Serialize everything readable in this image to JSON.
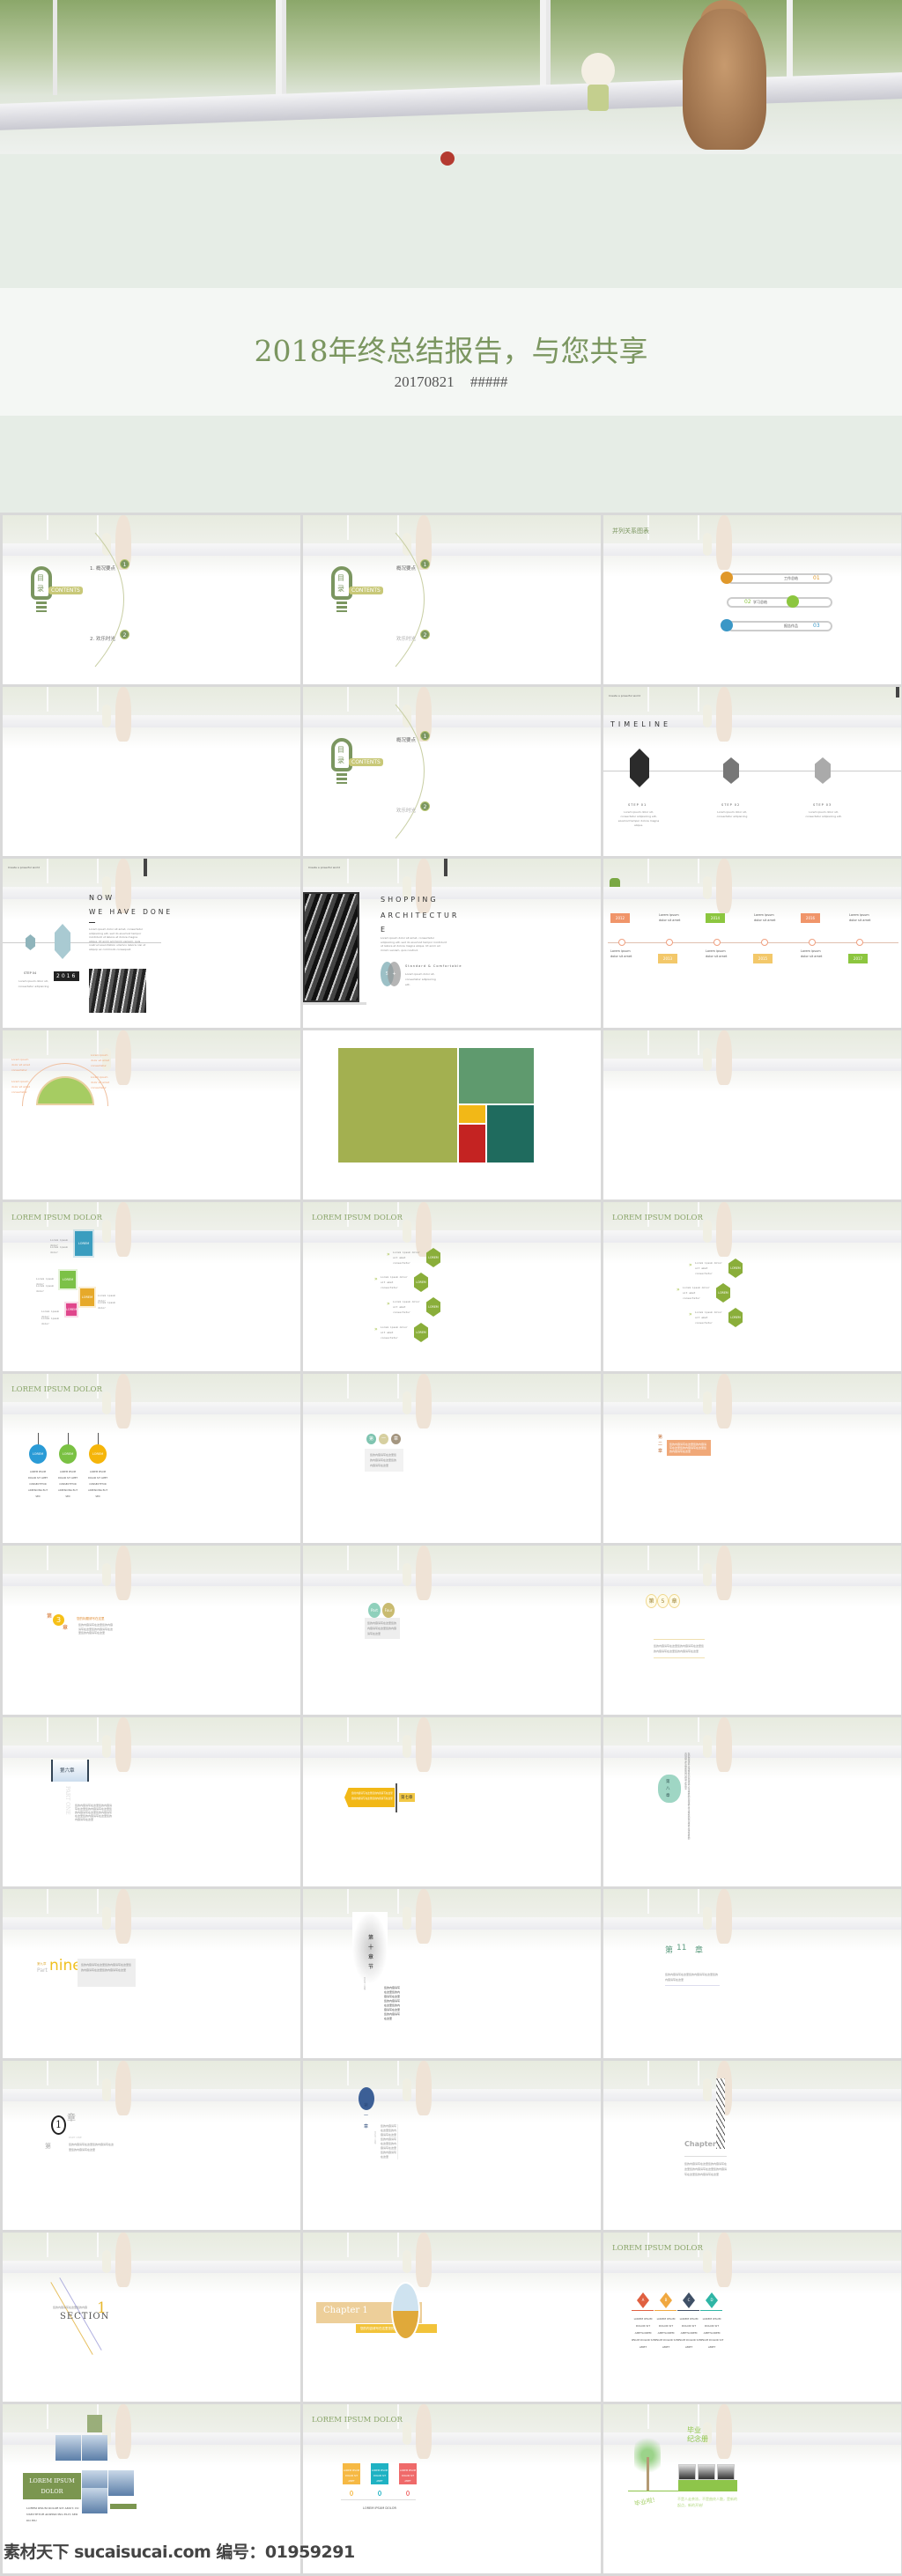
{
  "cover": {
    "title": "2018年终总结报告，与您共享",
    "date": "20170821",
    "author": "#####"
  },
  "colors": {
    "green": "#7b9660",
    "olive": "#8aa04a",
    "orange": "#f0956a",
    "yellow": "#f3c03a",
    "teal": "#3fb4c0",
    "lime": "#8cc63f"
  },
  "slides": [
    {
      "type": "contents",
      "bulb": [
        "目",
        "录"
      ],
      "label": "CONTENTS",
      "nums": [
        "1",
        "2"
      ],
      "items": [
        "1. 概况要点",
        "2. 欢乐时光"
      ]
    },
    {
      "type": "contents",
      "bulb": [
        "目",
        "录"
      ],
      "label": "CONTENTS",
      "nums": [
        "1",
        "2"
      ],
      "items": [
        "概况要点",
        "欢乐时光"
      ]
    },
    {
      "type": "parallel",
      "title": "并列关系图表",
      "items": [
        {
          "label": "工作总结",
          "num": "01"
        },
        {
          "label": "学习总结",
          "num": "02"
        },
        {
          "label": "报告作品",
          "num": "03"
        }
      ]
    },
    {
      "type": "blank"
    },
    {
      "type": "contents",
      "bulb": [
        "目",
        "录"
      ],
      "label": "CONTENTS",
      "nums": [
        "1",
        "2"
      ],
      "items": [
        "概况要点",
        "欢乐时光"
      ]
    },
    {
      "type": "timeline",
      "tag": "Create a powerful world",
      "title": "TIMELINE",
      "steps": [
        {
          "label": "STEP 01",
          "text": "Lorem ipsum dolor sit, consectetur adipisicing elit, eiusmod tempor dolore magna aliqua."
        },
        {
          "label": "STEP 02",
          "text": "Lorem ipsum dolor sit, consectetur adipisicing"
        },
        {
          "label": "STEP 03",
          "text": "Lorem ipsum dolor sit, consectetur adipisicing elit."
        }
      ]
    },
    {
      "type": "nowdone",
      "tag": "Create a powerful world",
      "title1": "NOW",
      "title2": "WE HAVE DONE",
      "step": "STEP 04",
      "steptext": "Lorem ipsum dolor sit, consectetur adipisicing",
      "year": "2016",
      "body": "Lorem ipsum dolor sit amet, consectetur adipisicing elit, sed do eiusmod tempor incididunt ut labore et dolore magna aliqua. Ut enim ad minim veniam, quis nostrud exercitation ullamco laboris nisi ut aliquip ex commodo consequat."
    },
    {
      "type": "shopping",
      "tag": "Create a powerful world",
      "title1": "SHOPPING",
      "title2": "ARCHITECTUR",
      "title3": "E",
      "body": "Lorem ipsum dolor sit amet, consectetur adipisicing elit, sed do eiusmod tempor incididunt ut labore et dolore magna aliqua. Ut enim ad minim veniam, quis nostrud.",
      "sub": "Standard & Comfortable",
      "subtext": "Lorem ipsum dolor sit, consectetur adipisicing elit.",
      "circles": [
        "S",
        "+"
      ]
    },
    {
      "type": "years",
      "top": [
        "2012",
        "2014",
        "2016"
      ],
      "bottom": [
        "2013",
        "2015",
        "2017"
      ],
      "text": "Lorem ipsum dolor sit amet"
    },
    {
      "type": "semicircle",
      "text": "Lorem ipsum dolor sit amet consectetur"
    },
    {
      "type": "treemap"
    },
    {
      "type": "blank"
    },
    {
      "type": "squares",
      "title": "LOREM IPSUM DOLOR",
      "box": "LOREM",
      "text": "Lorem ipsum dolor"
    },
    {
      "type": "hex4",
      "title": "LOREM IPSUM DOLOR",
      "box": "LOREM",
      "text": "Lorem ipsum dolor sit amet consectetur"
    },
    {
      "type": "hex3",
      "title": "LOREM IPSUM DOLOR",
      "box": "LOREM",
      "text": "Lorem ipsum dolor sit amet consectetur"
    },
    {
      "type": "tags",
      "title": "LOREM IPSUM DOLOR",
      "box": "LOREM",
      "text": "LOREM IPSUM DOLOR SIT AMET CONSECTETUR ADIPISICING ELIT SED"
    },
    {
      "type": "ch1circles",
      "chars": [
        "第",
        "一",
        "章"
      ],
      "text": "您的内容请写在这里您的内容请写在这里您的内容请写在这里"
    },
    {
      "type": "ch2",
      "chars": "第二章",
      "text": "您的内容请写在这里您的内容请写在这里您的内容请写在这里您的内容请写在这里"
    },
    {
      "type": "ch3",
      "chars": [
        "第",
        "3",
        "章"
      ],
      "heading": "您的标题请写在这里",
      "text": "您的内容请写在这里您的内容请写在这里您的内容请写在这里您的内容请写在这里"
    },
    {
      "type": "partfour",
      "chars": [
        "Part",
        "Four"
      ],
      "text": "您的内容请写在这里您的内容请写在这里您的内容请写在这里"
    },
    {
      "type": "ch5",
      "chars": [
        "第",
        "5",
        "章"
      ],
      "text": "您的内容请写在这里您的内容请写在这里您的内容请写在这里您的内容请写在这里"
    },
    {
      "type": "ch6",
      "chars": "第六章",
      "side": "PART ONE",
      "text": "您的内容请写在这里您的内容请写在这里您的内容请写在这里您的内容请写在这里您的内容请写在这里您的内容请写在这里您的内容请写在这里"
    },
    {
      "type": "ch7",
      "chars": "第七章",
      "text": "您的内容请写在这里您的内容请写在这里您的内容请写在这里您的内容请写在这里"
    },
    {
      "type": "ch8",
      "chars": "第八章",
      "text": "您的内容请写在这里您的内容请写在这里您的内容请写在这里您的内容请写在这里您的内容请写在这里您的内容请写在这里"
    },
    {
      "type": "nine",
      "small": "第九章",
      "part": "Part",
      "big": "nine",
      "text": "您的内容请写在这里您的内容请写在这里您的内容请写在这里您的内容请写在这里"
    },
    {
      "type": "ch10",
      "chars": "第十章节",
      "side": "PART ONE",
      "text": "您的内容请写在这里您的内容请写在这里您的内容请写在这里您的内容请写在这里您的内容请写在这里"
    },
    {
      "type": "ch11",
      "chars": [
        "第",
        "11",
        "章"
      ],
      "text": "您的内容请写在这里您的内容请写在这里您的内容请写在这里"
    },
    {
      "type": "ch1ring",
      "num": "1",
      "chars": [
        "第",
        "章"
      ],
      "side": "PART ONE",
      "text": "您的内容请写在这里您的内容请写在这里您的内容请写在这里"
    },
    {
      "type": "ch1blue",
      "chars": [
        "第",
        "一",
        "章"
      ],
      "side": "PART ONE",
      "text": "您的内容请写在这里您的内容请写在这里您的内容请写在这里您的内容请写在这里您的内容请写在这里"
    },
    {
      "type": "chapter",
      "title": "Chapter",
      "text": "您的内容请写在这里您的内容请写在这里您的内容请写在这里您的内容请写在这里您的内容请写在这里"
    },
    {
      "type": "section",
      "small": "您的内容请写在这里您的内容",
      "word": "SECTION",
      "num": "1"
    },
    {
      "type": "chapter1",
      "title": "Chapter 1",
      "text": "您的内容请写在这里您的内容"
    },
    {
      "type": "abcd",
      "title": "LOREM IPSUM DOLOR",
      "letters": [
        "A",
        "B",
        "C",
        "D"
      ],
      "text": "LOREM IPSUM DOLOR SIT AMETLOREM IPSUM DOLOR SIT AMET"
    },
    {
      "type": "photos",
      "title": "LOREM IPSUM DOLOR",
      "text": "LOREM IPSUM DOLOR SIT AMUT, CO NSECTETUR ADIPISICING ELIT, SED DO EIU"
    },
    {
      "type": "boxes3",
      "title": "LOREM IPSUM DOLOR",
      "box": "LOREM IPSUM DOLOR SIT AMET",
      "caption": "LOREM IPSUM DOLOR"
    },
    {
      "type": "grad",
      "title": [
        "毕业",
        "纪念册"
      ],
      "cheer": "毕业啦!",
      "text": "不是人走茶凉，不是曲终人散，是新的起点，新的开始!"
    }
  ],
  "watermark": "素材天下 sucaisucai.com  编号：01959291"
}
